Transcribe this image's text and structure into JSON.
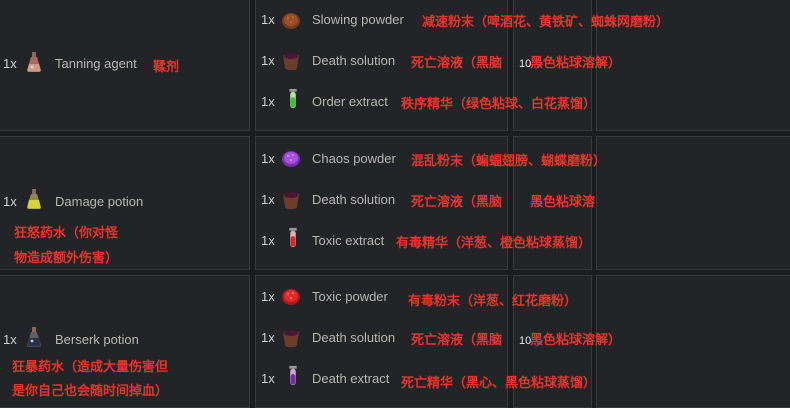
{
  "rows": [
    {
      "product": {
        "qty": "1x",
        "name": "Tanning agent",
        "cn": "鞣剂",
        "icon": "tanning-agent-flask-icon"
      },
      "ingredients": [
        {
          "qty": "1x",
          "name": "Slowing powder",
          "cn": "减速粉末（啤酒花、黄铁矿、蜘蛛网磨粉）",
          "icon": "slowing-powder-icon"
        },
        {
          "qty": "1x",
          "name": "Death solution",
          "cn": "死亡溶液（黑脑",
          "cn2": "黑色粘球溶解）",
          "overlay": "10",
          "icon": "death-solution-bowl-icon"
        },
        {
          "qty": "1x",
          "name": "Order extract",
          "cn": "秩序精华（绿色粘球、白花蒸馏）",
          "icon": "order-extract-vial-icon"
        }
      ]
    },
    {
      "product": {
        "qty": "1x",
        "name": "Damage potion",
        "cn_line1": "狂怒药水（你对怪",
        "cn_line2": "物造成额外伤害）",
        "icon": "damage-potion-flask-icon"
      },
      "ingredients": [
        {
          "qty": "1x",
          "name": "Chaos powder",
          "cn": "混乱粉末（蝙蝠翅膀、蝴蝶磨粉）",
          "icon": "chaos-powder-icon"
        },
        {
          "qty": "1x",
          "name": "Death solution",
          "cn": "死亡溶液（黑脑",
          "cn2": "黑色粘球溶",
          "icon": "death-solution-bowl-icon"
        },
        {
          "qty": "1x",
          "name": "Toxic extract",
          "cn": "有毒精华（洋葱、橙色粘球蒸馏）",
          "icon": "toxic-extract-vial-icon"
        }
      ]
    },
    {
      "product": {
        "qty": "1x",
        "name": "Berserk potion",
        "cn_line1": "狂暴药水（造成大量伤害但",
        "cn_line2": "是你自己也会随时间掉血）",
        "icon": "berserk-potion-flask-icon"
      },
      "ingredients": [
        {
          "qty": "1x",
          "name": "Toxic powder",
          "cn": "有毒粉末（洋葱、红花磨粉）",
          "icon": "toxic-powder-icon"
        },
        {
          "qty": "1x",
          "name": "Death solution",
          "cn": "死亡溶液（黑脑",
          "cn2": "黑色粘球溶解）",
          "overlay": "10",
          "icon": "death-solution-bowl-icon"
        },
        {
          "qty": "1x",
          "name": "Death extract",
          "cn": "死亡精华（黑心、黑色粘球蒸馏）",
          "icon": "death-extract-vial-icon"
        }
      ]
    }
  ],
  "colors": {
    "background": "#1b1c1e",
    "cell": "#232427",
    "border": "#38393c",
    "label": "#b9b6ae",
    "annotation_red": "#e8332b"
  }
}
